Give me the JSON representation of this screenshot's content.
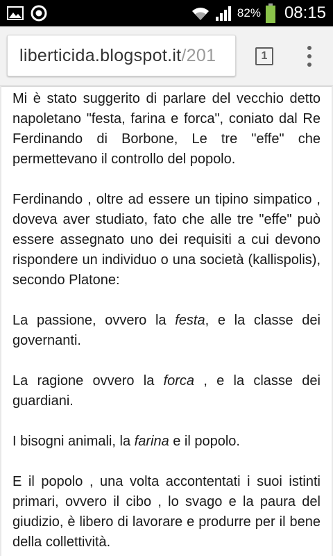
{
  "status_bar": {
    "left_icons": [
      "gallery-icon",
      "circle-app-icon"
    ],
    "right_icons": [
      "wifi-icon",
      "signal-icon",
      "battery-icon"
    ],
    "battery_percent": "82%",
    "time": "08:15",
    "battery_color": "#8bc34a"
  },
  "toolbar": {
    "url_domain": "liberticida.blogspot.it",
    "url_path": "/201",
    "tab_count": "1"
  },
  "article": {
    "p1": "Mi è stato suggerito di parlare del vecchio detto napoletano \"festa, farina e forca\", coniato dal Re Ferdinando di Borbone, Le tre \"effe\" che permettevano il controllo del popolo.",
    "p2": "Ferdinando , oltre ad essere un tipino simpatico , doveva aver studiato, fato che alle tre \"effe\" può essere assegnato uno dei requisiti a cui devono rispondere un individuo o una società (kallispolis), secondo Platone:",
    "p3": {
      "before": "La passione, ovvero la ",
      "em": "festa",
      "after": ", e la classe dei governanti."
    },
    "p4": {
      "before": "La ragione ovvero la ",
      "em": "forca",
      "after": " , e la classe dei guardiani."
    },
    "p5": {
      "before": "I bisogni animali, la ",
      "em": "farina",
      "after": " e il popolo."
    },
    "p6": "E il popolo , una volta accontentati i suoi istinti primari, ovvero il cibo , lo svago e la paura del giudizio, è libero di lavorare e produrre per il bene della collettività."
  }
}
